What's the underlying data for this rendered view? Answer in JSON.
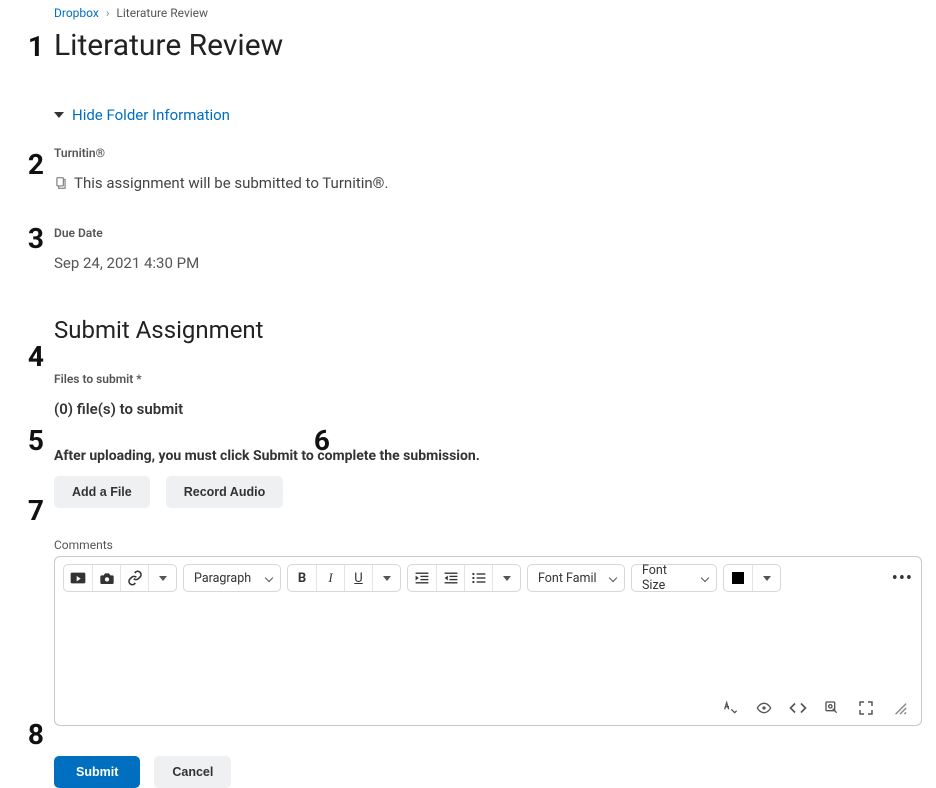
{
  "annotations": {
    "a1": "1",
    "a2": "2",
    "a3": "3",
    "a4": "4",
    "a5": "5",
    "a6": "6",
    "a7": "7",
    "a8": "8"
  },
  "breadcrumb": {
    "root": "Dropbox",
    "sep": "›",
    "leaf": "Literature Review"
  },
  "page_title": "Literature Review",
  "hide_folder": "Hide Folder Information",
  "turnitin": {
    "label": "Turnitin®",
    "msg": "This assignment will be submitted to Turnitin®."
  },
  "due": {
    "label": "Due Date",
    "value": "Sep 24, 2021 4:30 PM"
  },
  "submit_heading": "Submit Assignment",
  "files": {
    "label": "Files to submit *",
    "count_text": "(0) file(s) to submit",
    "hint": "After uploading, you must click Submit to complete the submission."
  },
  "buttons": {
    "add_file": "Add a File",
    "record_audio": "Record Audio",
    "submit": "Submit",
    "cancel": "Cancel"
  },
  "comments_label": "Comments",
  "toolbar": {
    "paragraph": "Paragraph",
    "font_family": "Font Famil",
    "font_size": "Font Size"
  }
}
